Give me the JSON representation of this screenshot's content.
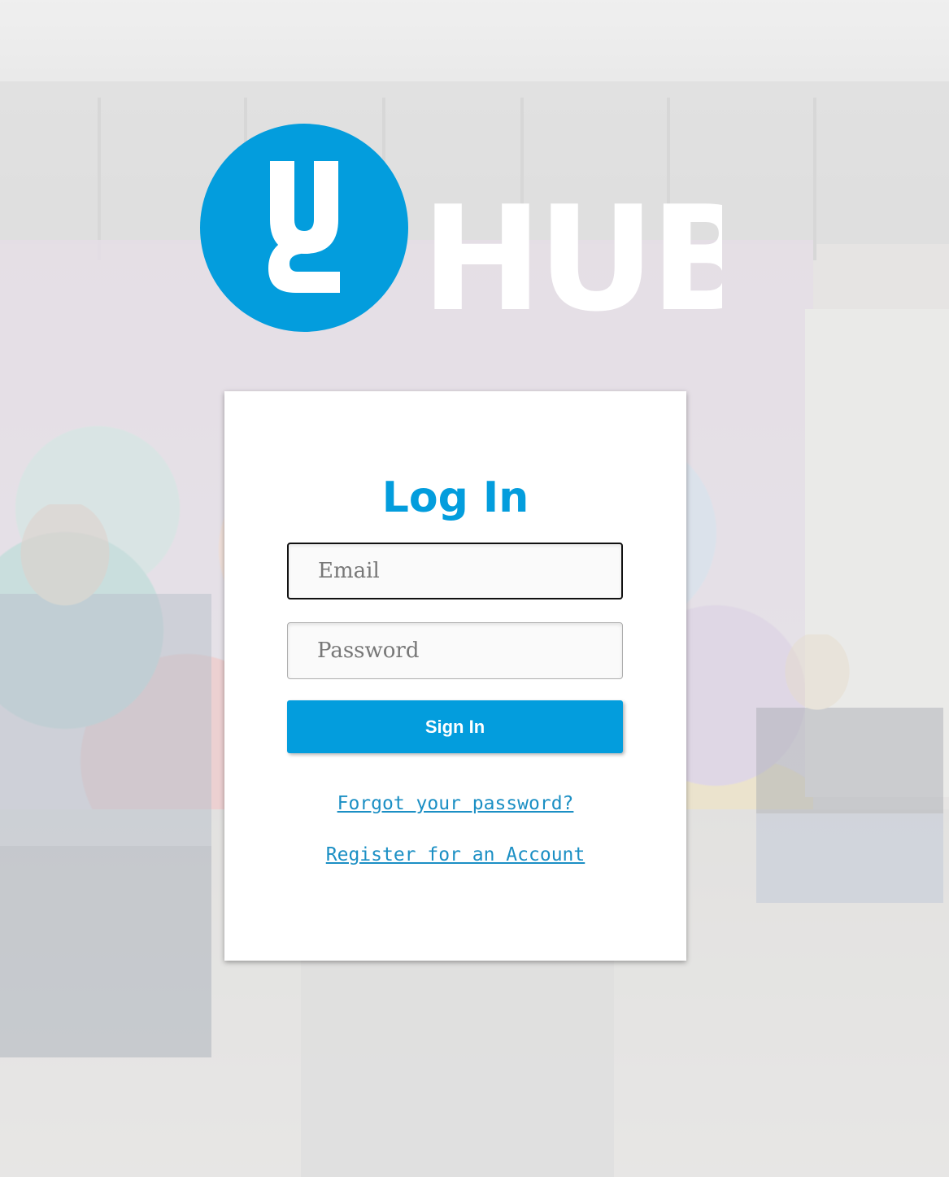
{
  "brand": {
    "logo_text": "HUB",
    "accent_color": "#039ddd",
    "logo_icon": "uc-logo-icon"
  },
  "login": {
    "title": "Log In",
    "email_placeholder": "Email",
    "password_placeholder": "Password",
    "signin_label": "Sign In",
    "forgot_label": "Forgot your password?",
    "register_label": "Register for an Account"
  }
}
